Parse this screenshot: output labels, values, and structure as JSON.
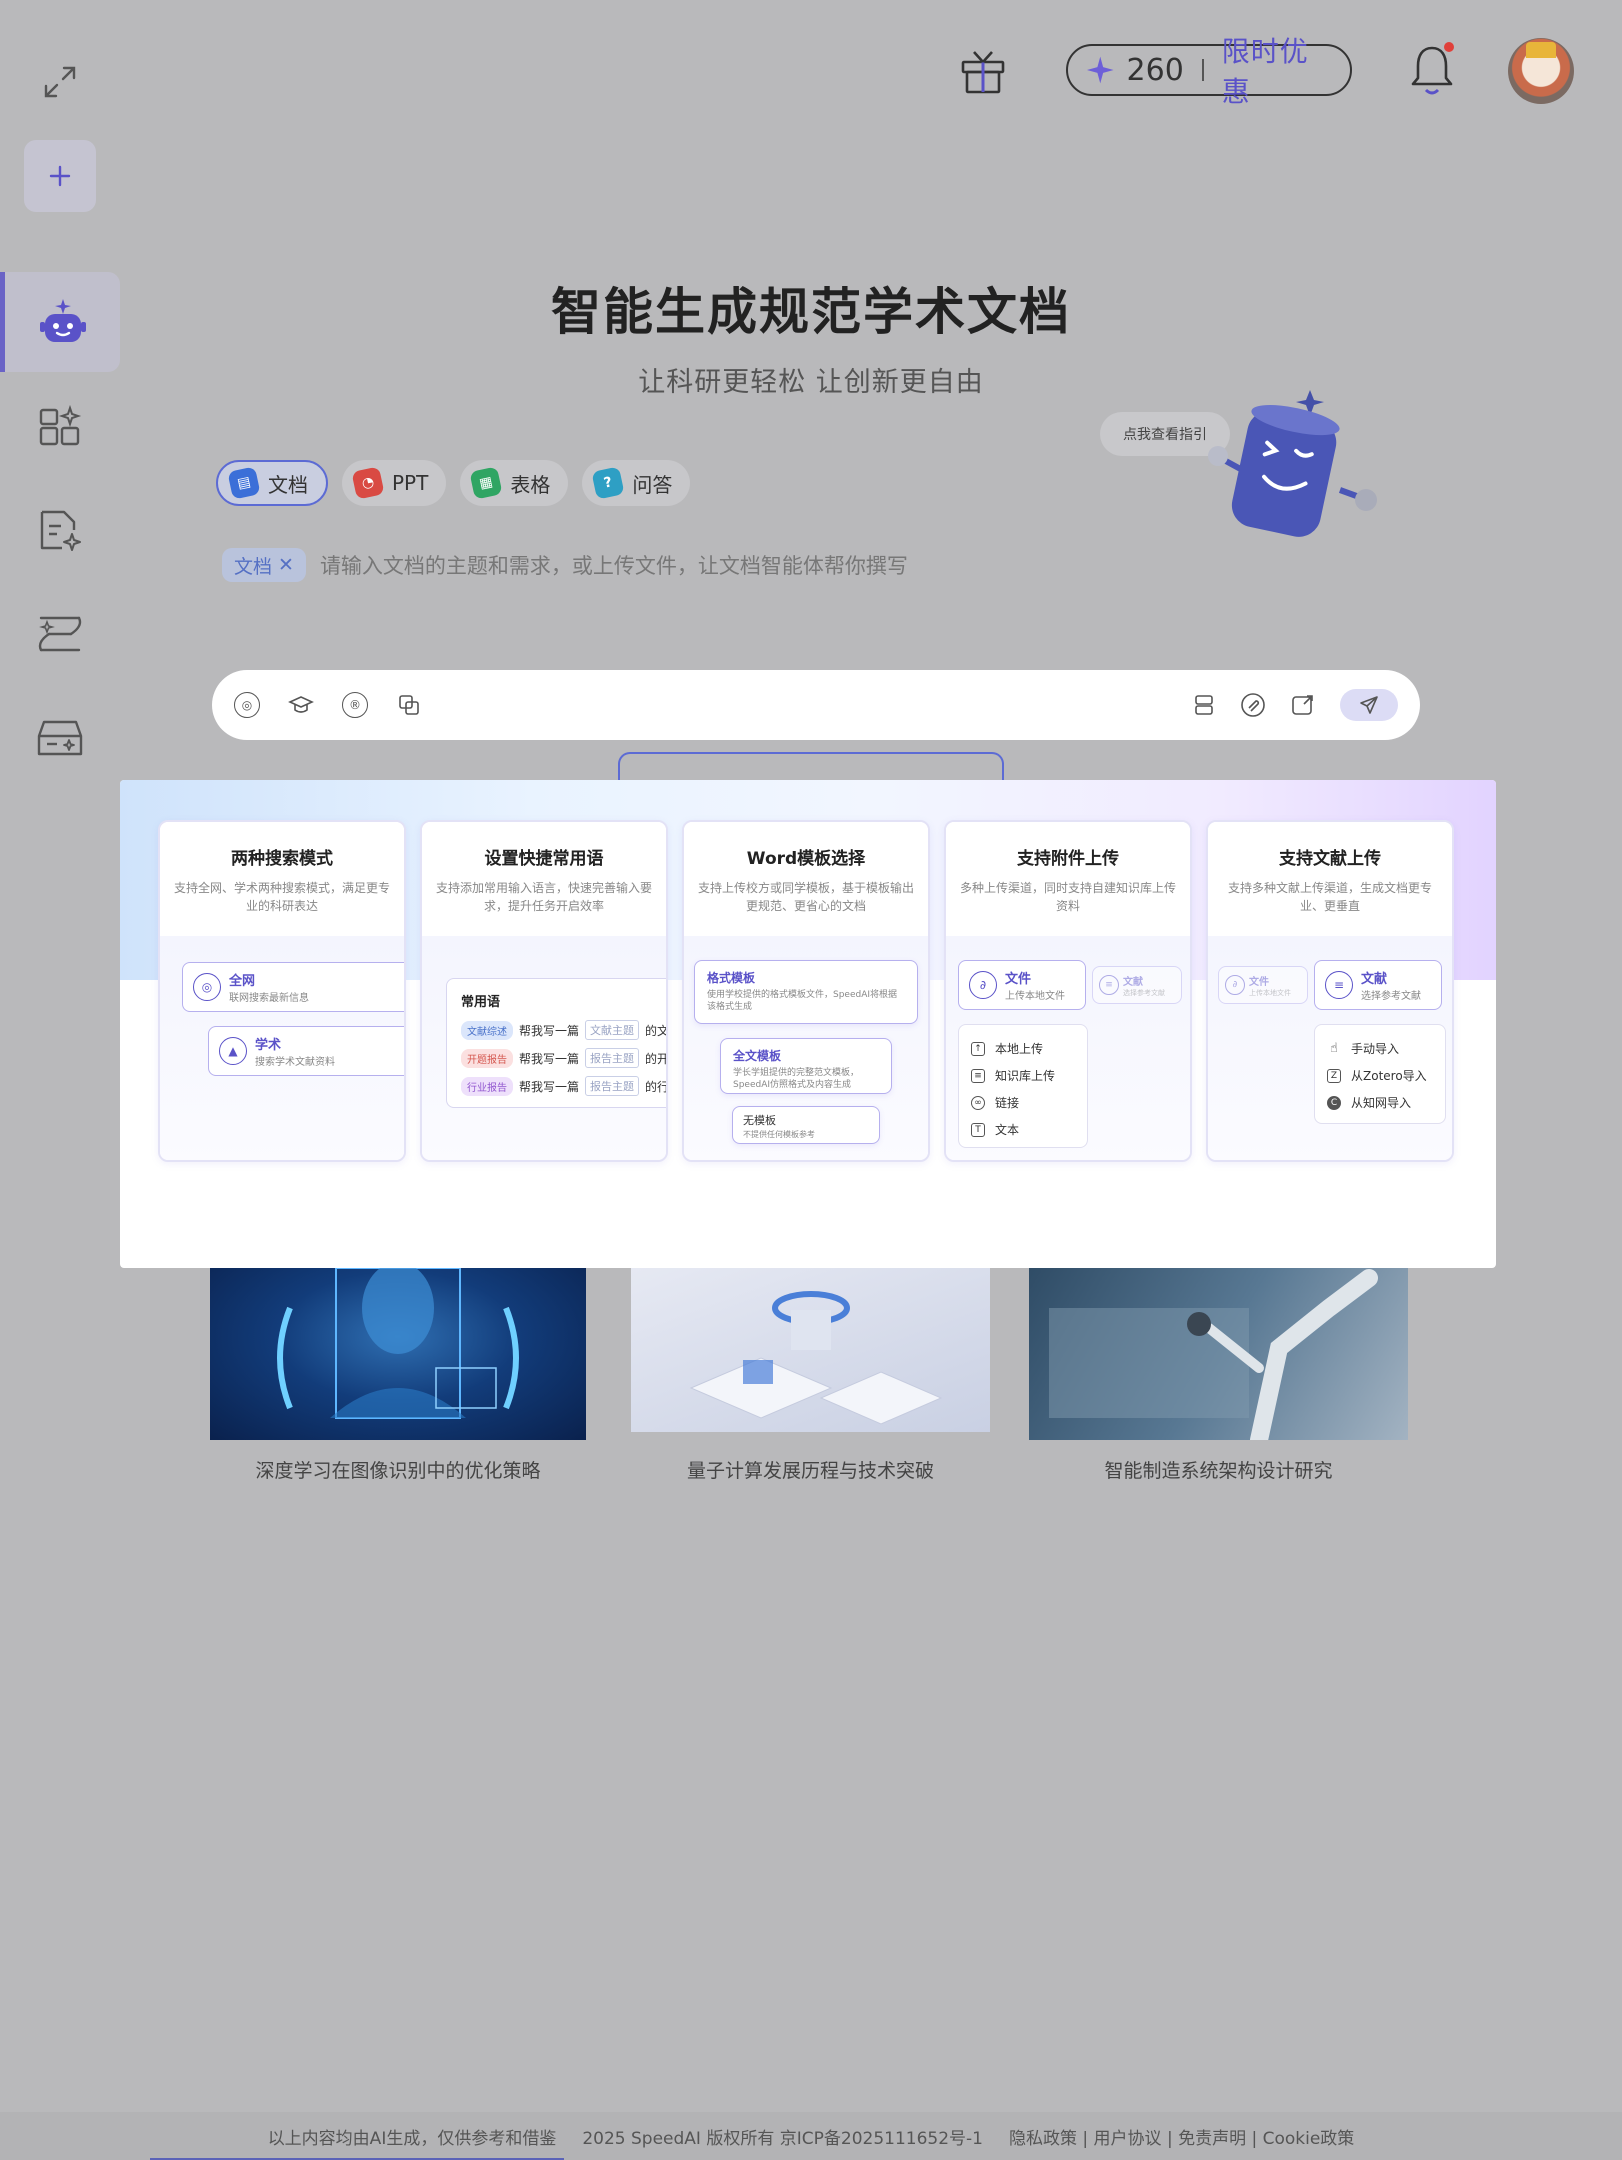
{
  "header": {
    "credits": "260",
    "promo_label": "限时优惠"
  },
  "hero": {
    "title": "智能生成规范学术文档",
    "subtitle": "让科研更轻松 让创新更自由",
    "guide_bubble": "点我查看指引"
  },
  "tabs": [
    {
      "label": "文档",
      "color": "#3b6fd8"
    },
    {
      "label": "PPT",
      "color": "#d94a43"
    },
    {
      "label": "表格",
      "color": "#2fa563"
    },
    {
      "label": "问答",
      "color": "#2e9fc4"
    }
  ],
  "input": {
    "chip": "文档",
    "placeholder": "请输入文档的主题和需求，或上传文件，让文档智能体帮你撰写"
  },
  "features": [
    {
      "title": "两种搜索模式",
      "desc": "支持全网、学术两种搜索模式，满足更专业的科研表达",
      "items": [
        {
          "title": "全网",
          "sub": "联网搜索最新信息"
        },
        {
          "title": "学术",
          "sub": "搜索学术文献资料"
        }
      ]
    },
    {
      "title": "设置快捷常用语",
      "desc": "支持添加常用输入语言，快速完善输入要求，提升任务开启效率",
      "box_title": "常用语",
      "rows": [
        {
          "tag": "文献综述",
          "text": "帮我写一篇",
          "slot": "文献主题",
          "tail": "的文",
          "tag_bg": "#dbe6fb",
          "tag_fg": "#4a72c9"
        },
        {
          "tag": "开题报告",
          "text": "帮我写一篇",
          "slot": "报告主题",
          "tail": "的开",
          "tag_bg": "#fbe0e0",
          "tag_fg": "#d4574f"
        },
        {
          "tag": "行业报告",
          "text": "帮我写一篇",
          "slot": "报告主题",
          "tail": "的行",
          "tag_bg": "#eee0fb",
          "tag_fg": "#9156cf"
        }
      ]
    },
    {
      "title": "Word模板选择",
      "desc": "支持上传校方或同学模板，基于模板输出更规范、更省心的文档",
      "templates": [
        {
          "title": "格式模板",
          "sub": "使用学校提供的格式模板文件，SpeedAI将根据该格式生成"
        },
        {
          "title": "全文模板",
          "sub": "学长学姐提供的完整范文模板，SpeedAI仿照格式及内容生成"
        },
        {
          "title": "无模板",
          "sub": "不提供任何模板参考"
        }
      ]
    },
    {
      "title": "支持附件上传",
      "desc": "多种上传渠道，同时支持自建知识库上传资料",
      "file": {
        "title": "文件",
        "sub": "上传本地文件"
      },
      "ghost": {
        "title": "文献",
        "sub": "选择参考文献"
      },
      "list": [
        "本地上传",
        "知识库上传",
        "链接",
        "文本"
      ]
    },
    {
      "title": "支持文献上传",
      "desc": "支持多种文献上传渠道，生成文档更专业、更垂直",
      "ghost": {
        "title": "文件",
        "sub": "上传本地文件"
      },
      "lit": {
        "title": "文献",
        "sub": "选择参考文献"
      },
      "list": [
        "手动导入",
        "从Zotero导入",
        "从知网导入"
      ]
    }
  ],
  "examples": [
    {
      "label": "深度学习在图像识别中的优化策略"
    },
    {
      "label": "量子计算发展历程与技术突破"
    },
    {
      "label": "智能制造系统架构设计研究"
    }
  ],
  "footer": {
    "disclaimer": "以上内容均由AI生成，仅供参考和借鉴",
    "copyright": "2025 SpeedAI 版权所有 京ICP备2025111652号-1",
    "links": "隐私政策 | 用户协议 | 免责声明 | Cookie政策"
  }
}
